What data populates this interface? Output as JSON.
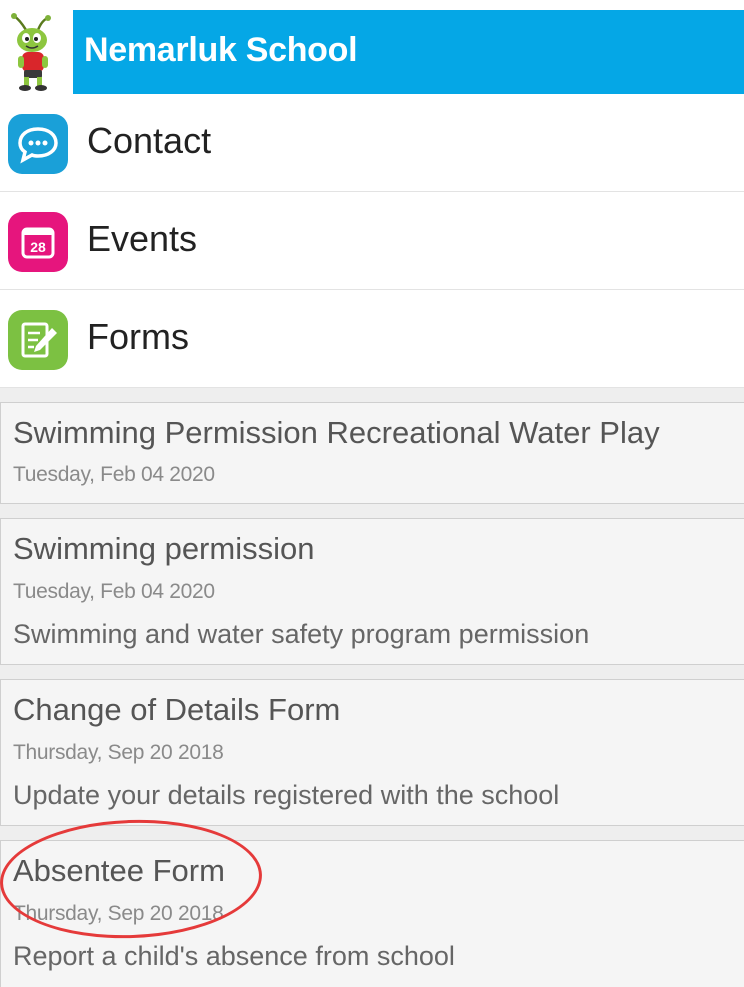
{
  "header": {
    "title": "Nemarluk School",
    "logo_icon": "ant-mascot-icon",
    "bar_color": "#05a7e6"
  },
  "nav": {
    "items": [
      {
        "label": "Contact",
        "icon": "chat-bubble-icon",
        "color": "#1aa0d8"
      },
      {
        "label": "Events",
        "icon": "calendar-icon",
        "icon_text": "28",
        "color": "#e6157d"
      },
      {
        "label": "Forms",
        "icon": "edit-form-icon",
        "color": "#7cc142"
      }
    ]
  },
  "forms": [
    {
      "title": "Swimming Permission Recreational Water Play",
      "date": "Tuesday, Feb 04 2020",
      "description": ""
    },
    {
      "title": "Swimming permission",
      "date": "Tuesday, Feb 04 2020",
      "description": "Swimming and water safety program permission"
    },
    {
      "title": "Change of Details Form",
      "date": "Thursday, Sep 20 2018",
      "description": "Update your details registered with the school"
    },
    {
      "title": "Absentee Form",
      "date": "Thursday, Sep 20 2018",
      "description": "Report a child's absence from school"
    }
  ],
  "annotation": {
    "color": "#e53a3a",
    "target": "Absentee Form"
  }
}
